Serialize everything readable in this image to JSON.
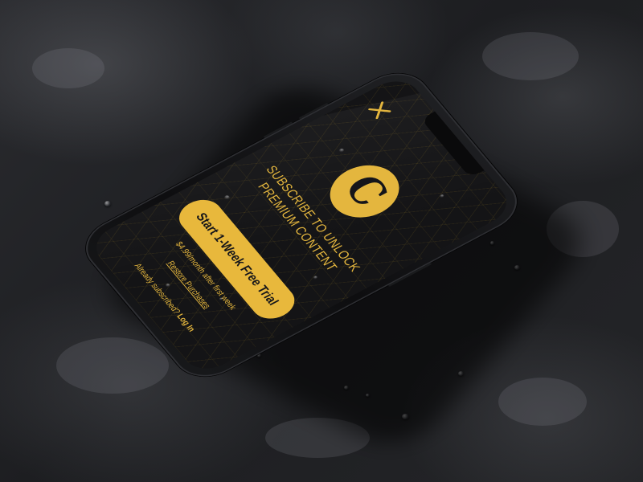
{
  "app": {
    "close_icon": "close-x-icon",
    "logo_letter": "C",
    "headline_line1": "SUBSCRIBE TO UNLOCK",
    "headline_line2": "PREMIUM CONTENT",
    "cta_label": "Start 1-Week Free Trial",
    "price_note": "$4.99/month after first week",
    "restore_label": "Restore Purchases",
    "already_text": "Already subscribed?",
    "login_label": "Log In"
  },
  "colors": {
    "accent": "#e4b63e",
    "screen_background": "#141416",
    "surface": "#1c1d20"
  }
}
